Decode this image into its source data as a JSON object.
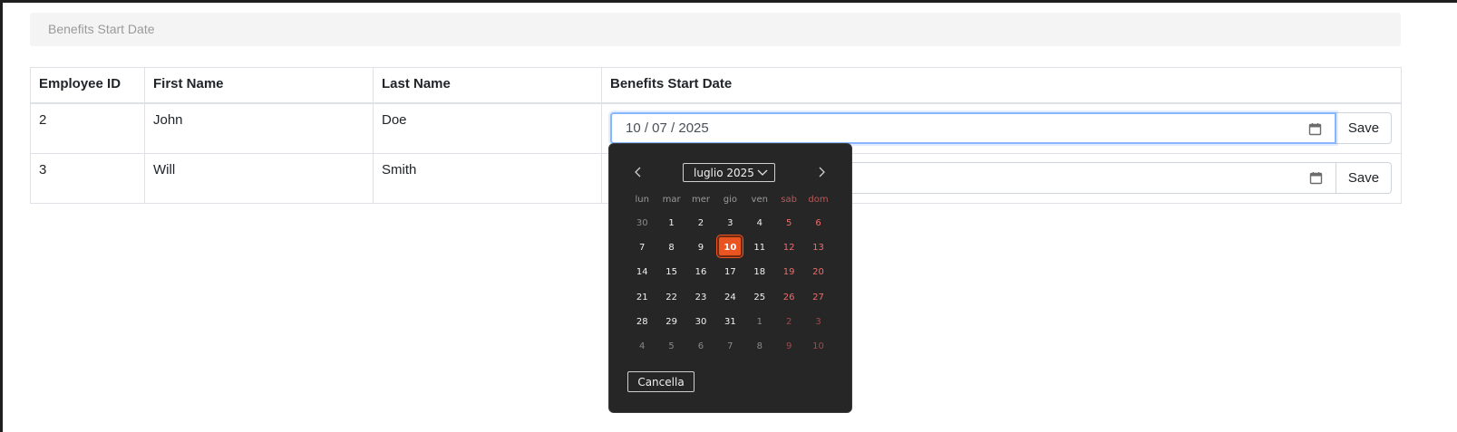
{
  "filter": {
    "placeholder": "Benefits Start Date"
  },
  "table": {
    "headers": [
      "Employee ID",
      "First Name",
      "Last Name",
      "Benefits Start Date"
    ],
    "rows": [
      {
        "id": "2",
        "first": "John",
        "last": "Doe",
        "date": "10 / 07 / 2025",
        "save": "Save"
      },
      {
        "id": "3",
        "first": "Will",
        "last": "Smith",
        "date": "",
        "save": "Save"
      }
    ]
  },
  "picker": {
    "month_label": "luglio 2025",
    "weekdays": [
      "lun",
      "mar",
      "mer",
      "gio",
      "ven",
      "sab",
      "dom"
    ],
    "weeks": [
      [
        "30",
        "1",
        "2",
        "3",
        "4",
        "5",
        "6"
      ],
      [
        "7",
        "8",
        "9",
        "10",
        "11",
        "12",
        "13"
      ],
      [
        "14",
        "15",
        "16",
        "17",
        "18",
        "19",
        "20"
      ],
      [
        "21",
        "22",
        "23",
        "24",
        "25",
        "26",
        "27"
      ],
      [
        "28",
        "29",
        "30",
        "31",
        "1",
        "2",
        "3"
      ],
      [
        "4",
        "5",
        "6",
        "7",
        "8",
        "9",
        "10"
      ]
    ],
    "selected_day": "10",
    "cancel_label": "Cancella"
  },
  "colors": {
    "accent": "#e95420",
    "focus_border": "#86b7fe",
    "picker_bg": "#262626"
  },
  "icons": {
    "calendar": "calendar-icon",
    "prev": "chevron-left-icon",
    "next": "chevron-right-icon"
  }
}
